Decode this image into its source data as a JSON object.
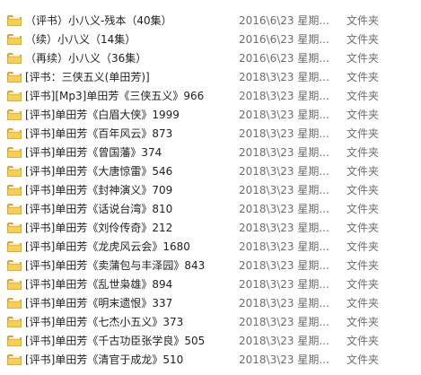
{
  "files": [
    {
      "name": "（评书）小八义-残本（40集）",
      "modified": "2016\\6\\23 星期...",
      "type": "文件夹",
      "icon": "folder-icon"
    },
    {
      "name": "（续）小八义（14集）",
      "modified": "2016\\6\\23 星期...",
      "type": "文件夹",
      "icon": "folder-icon"
    },
    {
      "name": "（再续）小八义（36集）",
      "modified": "2016\\6\\23 星期...",
      "type": "文件夹",
      "icon": "folder-icon"
    },
    {
      "name": "[评书：三侠五义(单田芳)]",
      "modified": "2018\\3\\23 星期...",
      "type": "文件夹",
      "icon": "folder-icon"
    },
    {
      "name": "[评书][Mp3]单田芳《三侠五义》966",
      "modified": "2018\\3\\23 星期...",
      "type": "文件夹",
      "icon": "folder-icon"
    },
    {
      "name": "[评书]单田芳《白眉大侠》1999",
      "modified": "2018\\3\\23 星期...",
      "type": "文件夹",
      "icon": "folder-icon"
    },
    {
      "name": "[评书]单田芳《百年风云》873",
      "modified": "2018\\3\\23 星期...",
      "type": "文件夹",
      "icon": "folder-icon"
    },
    {
      "name": "[评书]单田芳《曾国藩》374",
      "modified": "2018\\3\\23 星期...",
      "type": "文件夹",
      "icon": "folder-icon"
    },
    {
      "name": "[评书]单田芳《大唐惊雷》546",
      "modified": "2018\\3\\23 星期...",
      "type": "文件夹",
      "icon": "folder-icon"
    },
    {
      "name": "[评书]单田芳《封神演义》709",
      "modified": "2018\\3\\23 星期...",
      "type": "文件夹",
      "icon": "folder-icon"
    },
    {
      "name": "[评书]单田芳《话说台湾》810",
      "modified": "2018\\3\\23 星期...",
      "type": "文件夹",
      "icon": "folder-icon"
    },
    {
      "name": "[评书]单田芳《刘伶传奇》212",
      "modified": "2018\\3\\23 星期...",
      "type": "文件夹",
      "icon": "folder-icon"
    },
    {
      "name": "[评书]单田芳《龙虎风云会》1680",
      "modified": "2018\\3\\23 星期...",
      "type": "文件夹",
      "icon": "folder-icon"
    },
    {
      "name": "[评书]单田芳《卖蒲包与丰泽园》843",
      "modified": "2018\\3\\23 星期...",
      "type": "文件夹",
      "icon": "folder-icon"
    },
    {
      "name": "[评书]单田芳《乱世枭雄》894",
      "modified": "2018\\3\\23 星期...",
      "type": "文件夹",
      "icon": "folder-icon"
    },
    {
      "name": "[评书]单田芳《明末遗恨》337",
      "modified": "2018\\3\\23 星期...",
      "type": "文件夹",
      "icon": "folder-icon"
    },
    {
      "name": "[评书]单田芳《七杰小五义》373",
      "modified": "2018\\3\\23 星期...",
      "type": "文件夹",
      "icon": "folder-icon"
    },
    {
      "name": "[评书]单田芳《千古功臣张学良》505",
      "modified": "2018\\3\\23 星期...",
      "type": "文件夹",
      "icon": "folder-icon"
    },
    {
      "name": "[评书]单田芳《清官于成龙》510",
      "modified": "2018\\3\\23 星期...",
      "type": "文件夹",
      "icon": "folder-icon"
    }
  ],
  "colors": {
    "folder_front": "#f6cf57",
    "folder_back": "#e0a82e",
    "folder_paper": "#ffffff",
    "text_primary": "#1e1e1e",
    "text_secondary": "#6d6d6d",
    "background": "#ffffff"
  }
}
